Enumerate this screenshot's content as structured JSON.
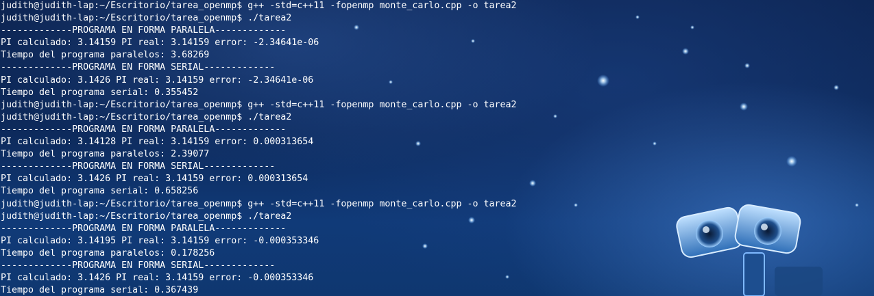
{
  "terminal": {
    "prompt": "judith@judith-lap:~/Escritorio/tarea_openmp$",
    "background": "#0c2350",
    "text_color": "#ffffff",
    "lines": [
      "judith@judith-lap:~/Escritorio/tarea_openmp$ g++ -std=c++11 -fopenmp monte_carlo.cpp -o tarea2",
      "judith@judith-lap:~/Escritorio/tarea_openmp$ ./tarea2",
      "-------------PROGRAMA EN FORMA PARALELA-------------",
      "PI calculado: 3.14159 PI real: 3.14159 error: -2.34641e-06",
      "Tiempo del programa paralelos: 3.68269",
      "-------------PROGRAMA EN FORMA SERIAL-------------",
      "PI calculado: 3.1426 PI real: 3.14159 error: -2.34641e-06",
      "Tiempo del programa serial: 0.355452",
      "judith@judith-lap:~/Escritorio/tarea_openmp$ g++ -std=c++11 -fopenmp monte_carlo.cpp -o tarea2",
      "judith@judith-lap:~/Escritorio/tarea_openmp$ ./tarea2",
      "-------------PROGRAMA EN FORMA PARALELA-------------",
      "PI calculado: 3.14128 PI real: 3.14159 error: 0.000313654",
      "Tiempo del programa paralelos: 2.39077",
      "-------------PROGRAMA EN FORMA SERIAL-------------",
      "PI calculado: 3.1426 PI real: 3.14159 error: 0.000313654",
      "Tiempo del programa serial: 0.658256",
      "judith@judith-lap:~/Escritorio/tarea_openmp$ g++ -std=c++11 -fopenmp monte_carlo.cpp -o tarea2",
      "judith@judith-lap:~/Escritorio/tarea_openmp$ ./tarea2",
      "-------------PROGRAMA EN FORMA PARALELA-------------",
      "PI calculado: 3.14195 PI real: 3.14159 error: -0.000353346",
      "Tiempo del programa paralelos: 0.178256",
      "-------------PROGRAMA EN FORMA SERIAL-------------",
      "PI calculado: 3.1426 PI real: 3.14159 error: -0.000353346",
      "Tiempo del programa serial: 0.367439"
    ]
  }
}
